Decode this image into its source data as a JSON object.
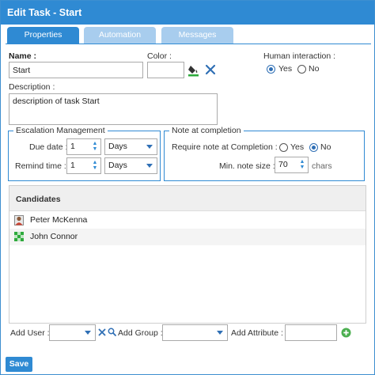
{
  "window": {
    "title": "Edit Task - Start"
  },
  "tabs": [
    {
      "label": "Properties",
      "active": true
    },
    {
      "label": "Automation",
      "active": false
    },
    {
      "label": "Messages",
      "active": false
    }
  ],
  "form": {
    "name_label": "Name :",
    "name_value": "Start",
    "color_label": "Color :",
    "color_value": "",
    "human_interaction_label": "Human interaction :",
    "yes_label": "Yes",
    "no_label": "No",
    "human_interaction_selected": "Yes",
    "description_label": "Description :",
    "description_value": "description of task Start"
  },
  "escalation": {
    "legend": "Escalation Management",
    "due_date_label": "Due date :",
    "due_date_value": "1",
    "due_date_unit": "Days",
    "remind_time_label": "Remind time :",
    "remind_time_value": "1",
    "remind_time_unit": "Days"
  },
  "note": {
    "legend": "Note at completion",
    "require_label": "Require note at Completion :",
    "yes_label": "Yes",
    "no_label": "No",
    "require_selected": "No",
    "min_size_label": "Min. note size :",
    "min_size_value": "70",
    "min_size_unit": "chars"
  },
  "candidates": {
    "header": "Candidates",
    "items": [
      {
        "name": "Peter McKenna",
        "icon": "user-icon"
      },
      {
        "name": "John Connor",
        "icon": "group-icon"
      }
    ]
  },
  "footer": {
    "add_user_label": "Add User :",
    "add_group_label": "Add Group :",
    "add_attribute_label": "Add Attribute :",
    "save_label": "Save"
  },
  "colors": {
    "accent": "#2f8ad3",
    "tab_inactive": "#a8cdee",
    "add_green": "#4caf50"
  }
}
